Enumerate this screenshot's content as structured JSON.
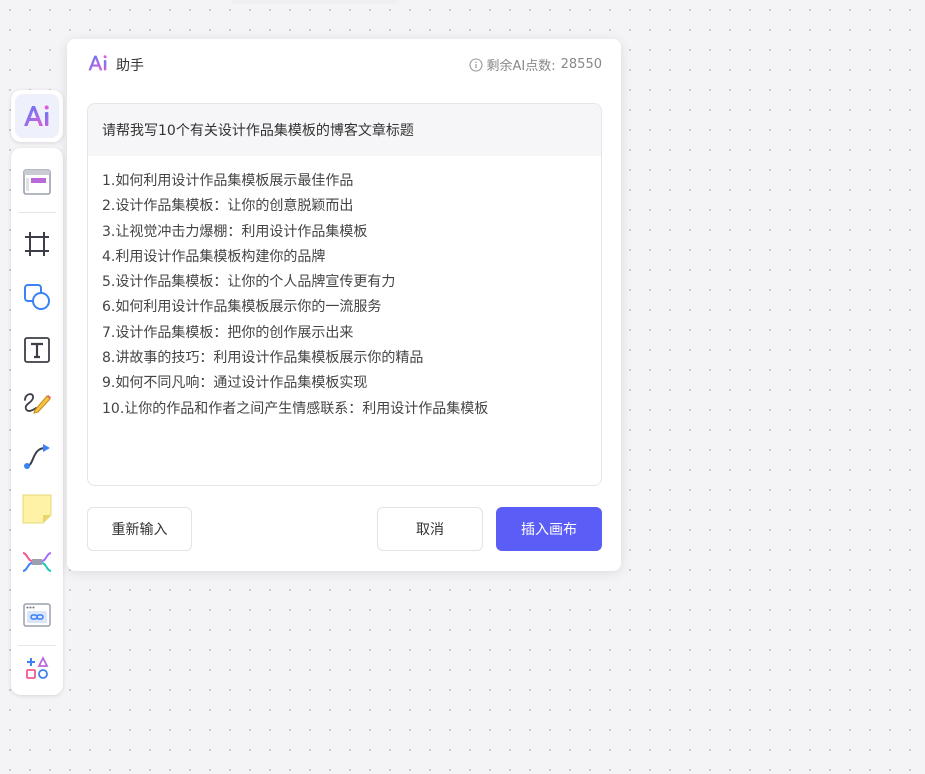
{
  "dialog": {
    "title": "助手",
    "credits_label": "剩余AI点数:",
    "credits_value": "28550",
    "prompt": "请帮我写10个有关设计作品集模板的博客文章标题",
    "results": [
      "1.如何利用设计作品集模板展示最佳作品",
      "2.设计作品集模板：让你的创意脱颖而出",
      "3.让视觉冲击力爆棚：利用设计作品集模板",
      "4.利用设计作品集模板构建你的品牌",
      "5.设计作品集模板：让你的个人品牌宣传更有力",
      "6.如何利用设计作品集模板展示你的一流服务",
      "7.设计作品集模板：把你的创作展示出来",
      "8.讲故事的技巧：利用设计作品集模板展示你的精品",
      "9.如何不同凡响：通过设计作品集模板实现",
      "10.让你的作品和作者之间产生情感联系：利用设计作品集模板"
    ],
    "buttons": {
      "reinput": "重新输入",
      "cancel": "取消",
      "insert": "插入画布"
    }
  },
  "toolbar": {
    "ai_tool_icon": "ai-logo-icon",
    "tools": [
      "template-icon",
      "frame-icon",
      "shape-icon",
      "text-icon",
      "pen-icon",
      "connector-icon",
      "sticky-note-icon",
      "mindmap-icon",
      "embed-link-icon",
      "more-tools-icon"
    ]
  },
  "colors": {
    "primary": "#5b5ef6",
    "canvas_bg": "#f4f4f6",
    "grid_dot": "#c9c9cf",
    "ai_gradient_start": "#4f7dff",
    "ai_gradient_end": "#e25ad8"
  }
}
